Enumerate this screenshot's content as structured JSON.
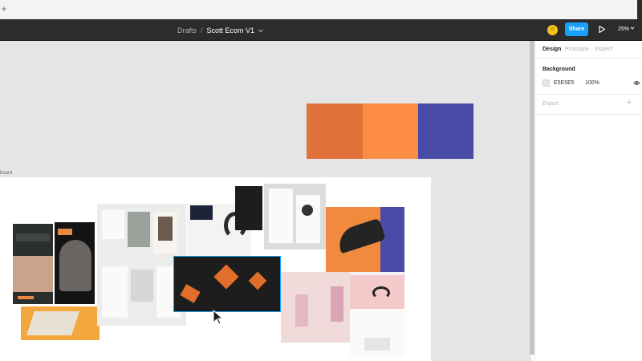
{
  "tabstrip": {
    "new_tab_label": "+"
  },
  "toolbar": {
    "breadcrumb_project": "Drafts",
    "breadcrumb_separator": "/",
    "file_name": "Scott Ecom V1",
    "avatar_initial": "G",
    "share_label": "Share",
    "zoom_label": "25%"
  },
  "canvas": {
    "background_color": "#E5E5E5",
    "frame_label": "board",
    "swatch_colors": [
      "#E1723A",
      "#FD8C46",
      "#4A4BA6"
    ]
  },
  "panel": {
    "tabs": [
      "Design",
      "Prototype",
      "Inspect"
    ],
    "active_tab": "Design",
    "background_title": "Background",
    "background_hex": "E5E5E5",
    "background_opacity": "100%",
    "export_label": "Export"
  },
  "icons": {
    "chevron": "chevron-down-icon",
    "play": "play-icon",
    "eye": "eye-icon",
    "plus": "plus-icon",
    "cursor": "cursor-arrow-icon"
  }
}
